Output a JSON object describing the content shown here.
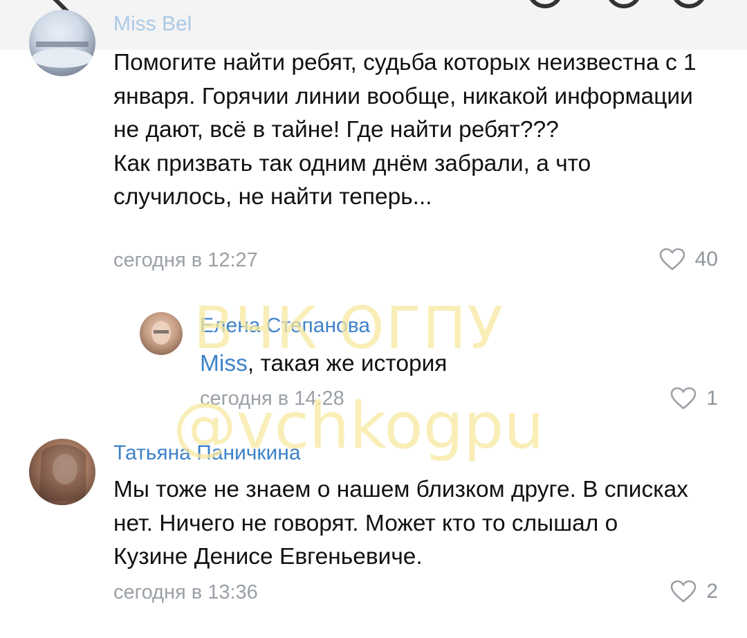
{
  "watermark": {
    "line1": "ВЧК ОГПУ",
    "line2": "@vchkogpu"
  },
  "comments": [
    {
      "author": "Miss Bel",
      "text": "Помогите найти ребят, судьба которых неизвестна с 1 января. Горячии линии вообще, никакой информации не дают, всё в тайне! Где найти ребят???\nКак призвать так одним днём забрали, а что случилось, не найти теперь...",
      "time": "сегодня в 12:27",
      "likes": "40"
    },
    {
      "author": "Елена Степанова",
      "mention": "Miss",
      "text": ", такая же история",
      "time": "сегодня в 14:28",
      "likes": "1"
    },
    {
      "author": "Татьяна Паничкина",
      "text": "Мы тоже не знаем о нашем близком друге. В списках нет. Ничего не говорят. Может кто то слышал о Кузине Денисе Евгеньевиче.",
      "time": "сегодня в 13:36",
      "likes": "2"
    }
  ]
}
